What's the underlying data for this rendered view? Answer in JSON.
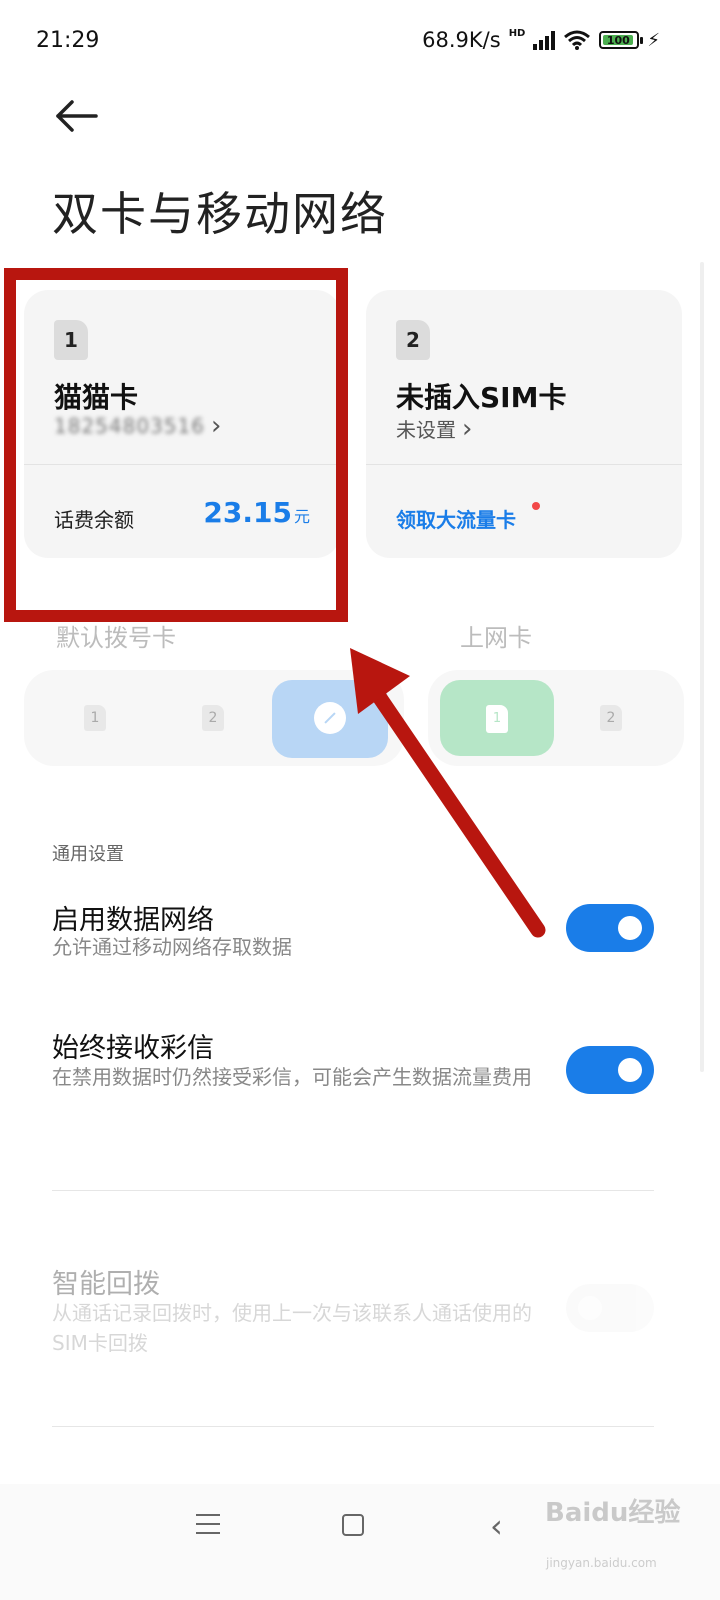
{
  "status_bar": {
    "time": "21:29",
    "net_speed": "68.9K/s",
    "signal_label": "HD",
    "battery": "100"
  },
  "header": {
    "title": "双卡与移动网络"
  },
  "sim_cards": [
    {
      "slot": "1",
      "name": "猫猫卡",
      "number": "18254803516",
      "balance_label": "话费余额",
      "balance_value": "23.15",
      "balance_unit": "元"
    },
    {
      "slot": "2",
      "name": "未插入SIM卡",
      "status": "未设置",
      "promo": "领取大流量卡"
    }
  ],
  "default_dial": {
    "label": "默认拨号卡",
    "options": [
      "1",
      "2"
    ]
  },
  "data_card": {
    "label": "上网卡",
    "options": [
      "1",
      "2"
    ],
    "selected": "1"
  },
  "general": {
    "section_label": "通用设置",
    "items": [
      {
        "title": "启用数据网络",
        "desc": "允许通过移动网络存取数据",
        "enabled": true
      },
      {
        "title": "始终接收彩信",
        "desc": "在禁用数据时仍然接受彩信，可能会产生数据流量费用",
        "enabled": true
      },
      {
        "title": "智能回拨",
        "desc": "从通话记录回拨时，使用上一次与该联系人通话使用的SIM卡回拨",
        "enabled": false
      }
    ]
  },
  "watermark": {
    "brand": "Baidu经验",
    "domain": "jingyan.baidu.com"
  },
  "colors": {
    "accent": "#1a7de8",
    "highlight_red": "#b8160f",
    "data_green": "#b6e6c7"
  }
}
